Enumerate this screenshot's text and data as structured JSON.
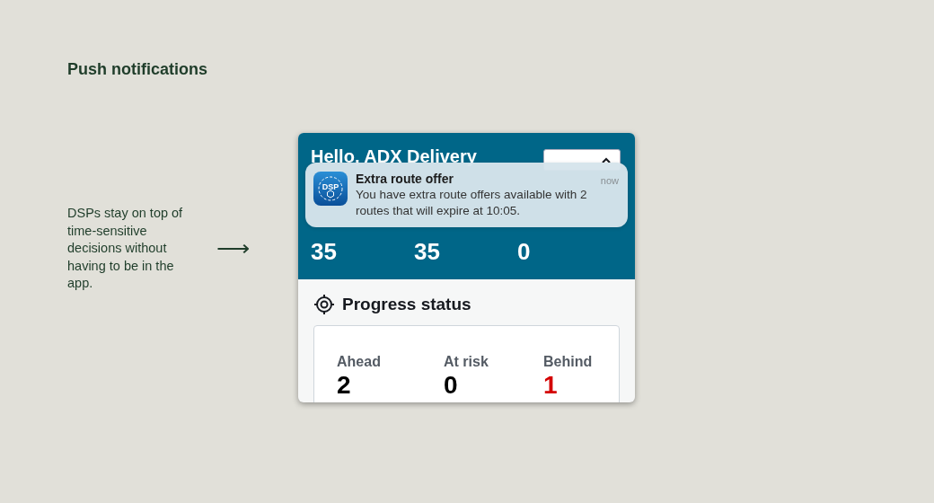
{
  "heading": "Push notifications",
  "description": "DSPs stay on top of time-sensitive decisions without having to be in the app.",
  "arrow": "⟶",
  "phone": {
    "greeting": "Hello, ADX Delivery",
    "stats": [
      {
        "value": "35"
      },
      {
        "value": "35"
      },
      {
        "value": "0"
      }
    ],
    "notification": {
      "app_icon_label": "DSP",
      "title": "Extra route offer",
      "time": "now",
      "body": "You have extra route offers available with 2 routes that will expire at 10:05."
    },
    "progress": {
      "title": "Progress status",
      "items": [
        {
          "label": "Ahead",
          "value": "2",
          "color": "#000000"
        },
        {
          "label": "At risk",
          "value": "0",
          "color": "#000000"
        },
        {
          "label": "Behind",
          "value": "1",
          "color": "#d40000"
        }
      ]
    }
  }
}
